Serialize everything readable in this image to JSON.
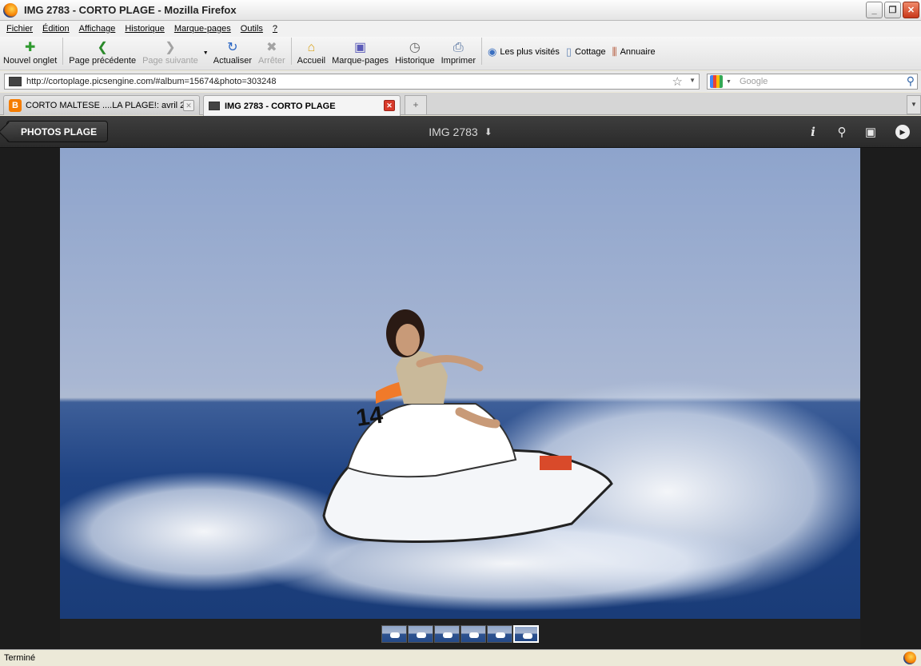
{
  "window": {
    "title": "IMG 2783 - CORTO PLAGE - Mozilla Firefox"
  },
  "menu": [
    "Fichier",
    "Édition",
    "Affichage",
    "Historique",
    "Marque-pages",
    "Outils",
    "?"
  ],
  "toolbar": {
    "new_tab": "Nouvel onglet",
    "back": "Page précédente",
    "forward": "Page suivante",
    "reload": "Actualiser",
    "stop": "Arrêter",
    "home": "Accueil",
    "bookmarks": "Marque-pages",
    "history": "Historique",
    "print": "Imprimer"
  },
  "bookmarks_bar": [
    "Les plus visités",
    "Cottage",
    "Annuaire"
  ],
  "url": "http://cortoplage.picsengine.com/#album=15674&photo=303248",
  "search": {
    "placeholder": "Google"
  },
  "tabs": [
    {
      "label": "CORTO MALTESE ....LA PLAGE!: avril 2...",
      "active": false
    },
    {
      "label": "IMG 2783 - CORTO PLAGE",
      "active": true
    }
  ],
  "gallery": {
    "back_label": "PHOTOS PLAGE",
    "photo_title": "IMG 2783",
    "icons": [
      "info-icon",
      "map-pin-icon",
      "camera-icon",
      "play-icon"
    ],
    "thumbnails": 6,
    "current_thumbnail": 6
  },
  "photo_text": {
    "jetski_number": "14"
  },
  "status": "Terminé"
}
